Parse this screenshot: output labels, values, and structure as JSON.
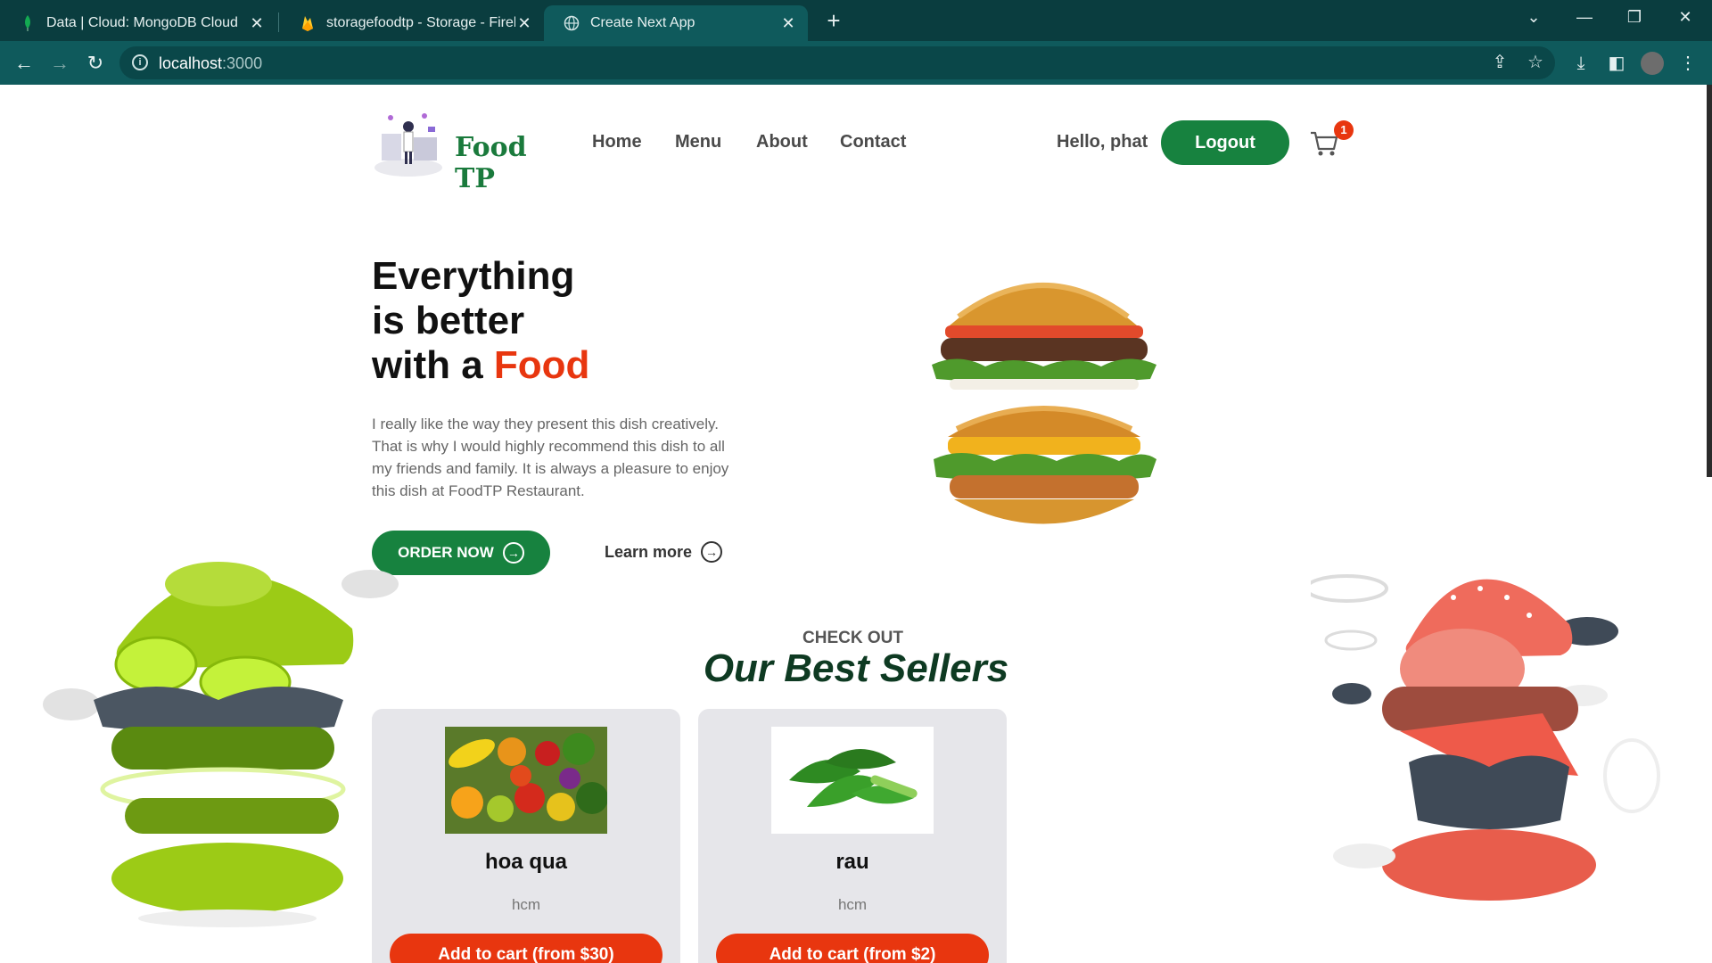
{
  "browser": {
    "tabs": [
      {
        "title": "Data | Cloud: MongoDB Cloud",
        "icon": "mongodb-leaf-icon"
      },
      {
        "title": "storagefoodtp - Storage - Fireba",
        "icon": "firebase-flame-icon"
      },
      {
        "title": "Create Next App",
        "icon": "globe-icon",
        "active": true
      }
    ],
    "new_tab": "+",
    "url_host": "localhost",
    "url_port": ":3000"
  },
  "header": {
    "logo_text": "Food TP",
    "nav": [
      "Home",
      "Menu",
      "About",
      "Contact"
    ],
    "greeting": "Hello, phat",
    "logout_label": "Logout",
    "cart_count": "1"
  },
  "hero": {
    "title_line1": "Everything",
    "title_line2": "is better",
    "title_line3_prefix": "with a ",
    "title_line3_accent": "Food",
    "description": "I really like the way they present this dish creatively. That is why I would highly recommend this dish to all my friends and family. It is always a pleasure to enjoy this dish at FoodTP Restaurant.",
    "order_label": "ORDER NOW",
    "learn_label": "Learn more"
  },
  "best_sellers": {
    "kicker": "CHECK OUT",
    "heading": "Our Best Sellers",
    "items": [
      {
        "name": "hoa qua",
        "location": "hcm",
        "button": "Add to cart (from $30)"
      },
      {
        "name": "rau",
        "location": "hcm",
        "button": "Add to cart (from $2)"
      }
    ]
  },
  "colors": {
    "brand_green": "#17823f",
    "accent_orange": "#e8360f",
    "chrome_teal": "#0f5a5c"
  }
}
